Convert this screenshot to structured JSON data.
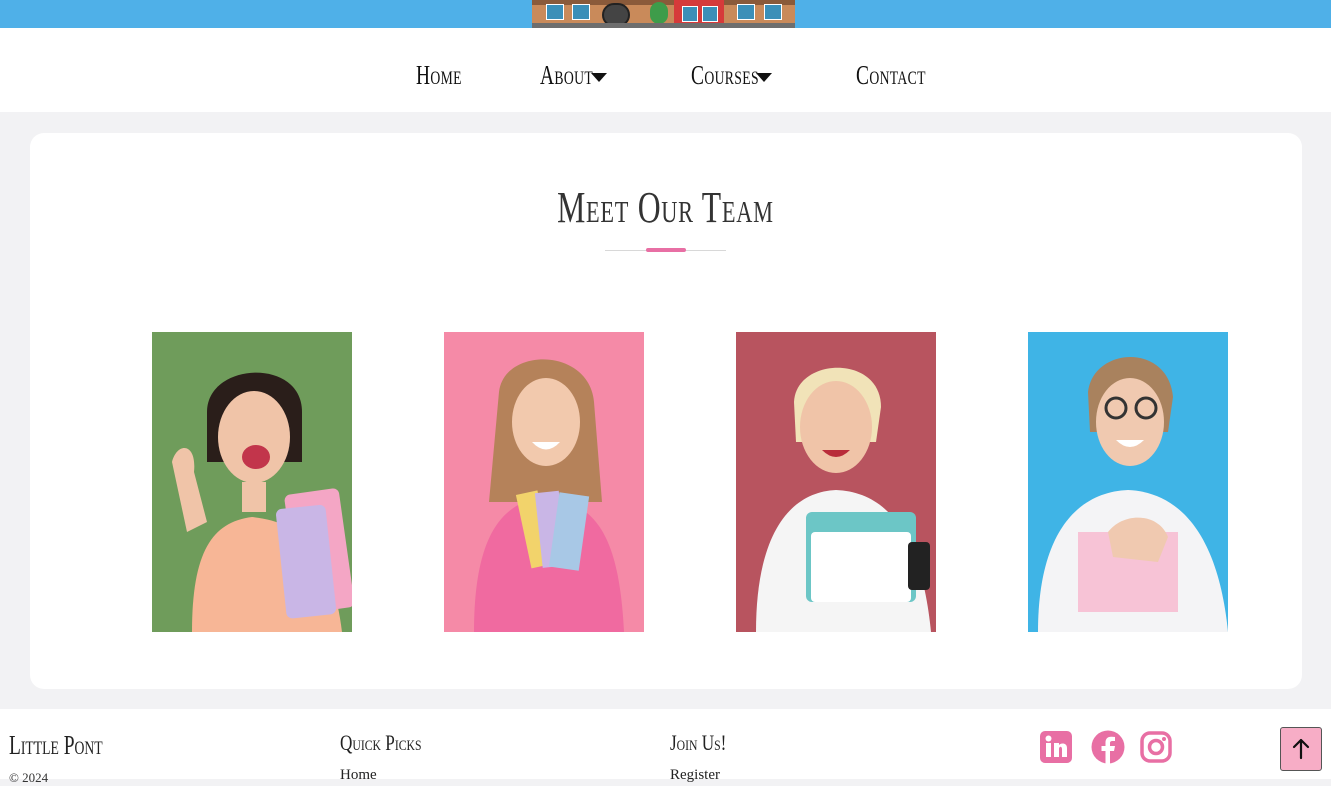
{
  "nav": {
    "home": "Home",
    "about": "About",
    "courses": "Courses",
    "contact": "Contact"
  },
  "team": {
    "title": "Meet Our Team",
    "members": [
      {
        "photo": "team-member-1-photo",
        "bg": "#6f9c5b"
      },
      {
        "photo": "team-member-2-photo",
        "bg": "#f58aa7"
      },
      {
        "photo": "team-member-3-photo",
        "bg": "#b8545f"
      },
      {
        "photo": "team-member-4-photo",
        "bg": "#3fb4e6"
      }
    ]
  },
  "footer": {
    "brand": "Little Pont",
    "copyright": "© 2024",
    "quick_picks_title": "Quick Picks",
    "quick_picks_link": "Home",
    "join_title": "Join Us!",
    "join_link": "Register",
    "social_icons": [
      "linkedin-icon",
      "facebook-icon",
      "instagram-icon"
    ],
    "accent": "#e86fa4",
    "to_top_icon": "arrow-up-icon"
  }
}
